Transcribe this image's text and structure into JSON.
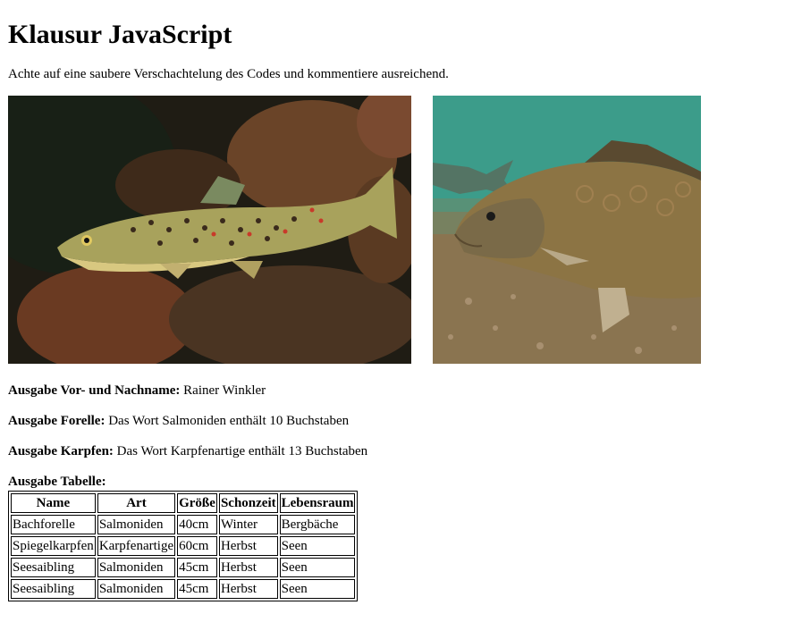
{
  "heading": "Klausur JavaScript",
  "intro": "Achte auf eine saubere Verschachtelung des Codes und kommentiere ausreichend.",
  "outputs": {
    "name": {
      "label": "Ausgabe Vor- und Nachname:",
      "value": " Rainer Winkler"
    },
    "forelle": {
      "label": "Ausgabe Forelle:",
      "value": " Das Wort Salmoniden enthält 10 Buchstaben"
    },
    "karpfen": {
      "label": "Ausgabe Karpfen:",
      "value": " Das Wort Karpfenartige enthält 13 Buchstaben"
    },
    "tabelle": {
      "label": "Ausgabe Tabelle:"
    }
  },
  "table": {
    "headers": [
      "Name",
      "Art",
      "Größe",
      "Schonzeit",
      "Lebensraum"
    ],
    "rows": [
      [
        "Bachforelle",
        "Salmoniden",
        "40cm",
        "Winter",
        "Bergbäche"
      ],
      [
        "Spiegelkarpfen",
        "Karpfenartige",
        "60cm",
        "Herbst",
        "Seen"
      ],
      [
        "Seesaibling",
        "Salmoniden",
        "45cm",
        "Herbst",
        "Seen"
      ],
      [
        "Seesaibling",
        "Salmoniden",
        "45cm",
        "Herbst",
        "Seen"
      ]
    ]
  },
  "colors": {
    "trout_bg": "#2a2418",
    "trout_rock": "#6a3e24",
    "trout_body": "#a3a35a",
    "carp_water": "#3a9a88",
    "carp_ground": "#8a7450",
    "carp_body": "#8a7040"
  }
}
